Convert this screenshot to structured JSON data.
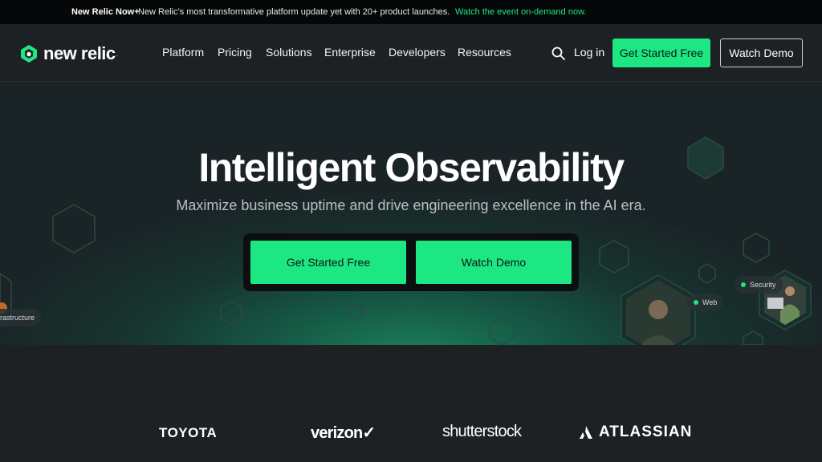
{
  "announcement": {
    "highlight": "New Relic Now+",
    "message": "New Relic’s most transformative platform update yet with 20+ product launches.",
    "cta": "Watch the event on-demand now."
  },
  "nav": {
    "logo_text": "new relic",
    "logo_mark": ".",
    "items": [
      "Platform",
      "Pricing",
      "Solutions",
      "Enterprise",
      "Developers",
      "Resources"
    ],
    "login": "Log in",
    "get_started": "Get Started Free",
    "watch_demo": "Watch Demo",
    "search_icon": "search-icon"
  },
  "hero": {
    "title": "Intelligent Observability",
    "subtitle": "Maximize business uptime and drive engineering excellence in the AI era.",
    "primary_cta": "Get Started Free",
    "secondary_cta": "Watch Demo",
    "tags": [
      "Security",
      "Web",
      "rastructure"
    ]
  },
  "customers": {
    "logos": [
      "TOYOTA",
      "verizon✓",
      "shutterstock",
      "ATLASSIAN"
    ]
  },
  "colors": {
    "accent": "#1ce783",
    "background": "#1d2124",
    "banner": "#050708"
  }
}
